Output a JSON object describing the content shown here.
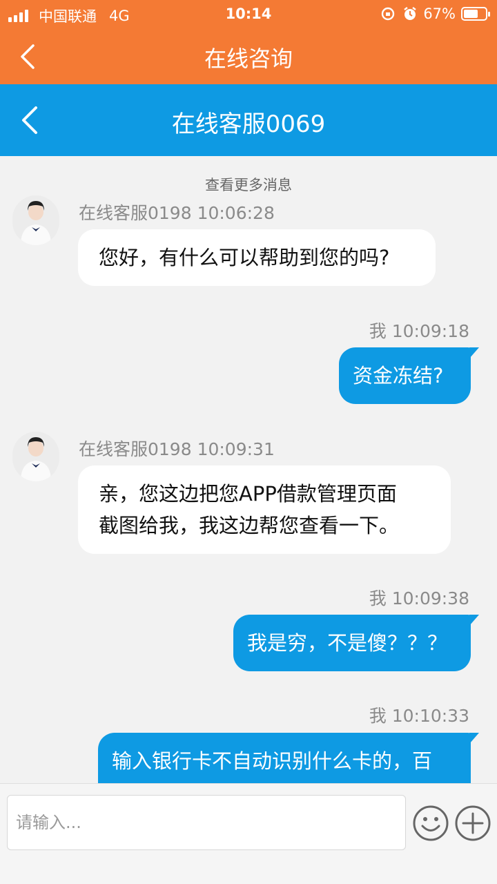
{
  "status": {
    "carrier": "中国联通",
    "network": "4G",
    "time": "10:14",
    "battery": "67%",
    "battery_level": 0.67
  },
  "nav": {
    "title": "在线咨询"
  },
  "chat_header": {
    "title": "在线客服0069"
  },
  "chat": {
    "load_more": "查看更多消息",
    "messages": [
      {
        "direction": "in",
        "meta": "在线客服0198 10:06:28",
        "lines": [
          "您好，有什么可以帮助到您的吗?"
        ]
      },
      {
        "direction": "out",
        "meta": "我 10:09:18",
        "lines": [
          "资金冻结?"
        ]
      },
      {
        "direction": "in",
        "meta": "在线客服0198 10:09:31",
        "lines": [
          "亲，您这边把您APP借款管理页面",
          "截图给我，我这边帮您查看一下。"
        ]
      },
      {
        "direction": "out",
        "meta": "我 10:09:38",
        "lines": [
          "我是穷，不是傻？？？"
        ]
      },
      {
        "direction": "out",
        "meta": "我 10:10:33",
        "lines": [
          "输入银行卡不自动识别什么卡的，百"
        ]
      }
    ]
  },
  "input": {
    "placeholder": "请输入..."
  },
  "colors": {
    "accent_orange": "#f47a34",
    "accent_blue": "#0e9ae3",
    "background": "#f2f2f2"
  },
  "icons": [
    "back-icon",
    "emoji-icon",
    "plus-icon",
    "alarm-icon",
    "lock-rotation-icon"
  ]
}
